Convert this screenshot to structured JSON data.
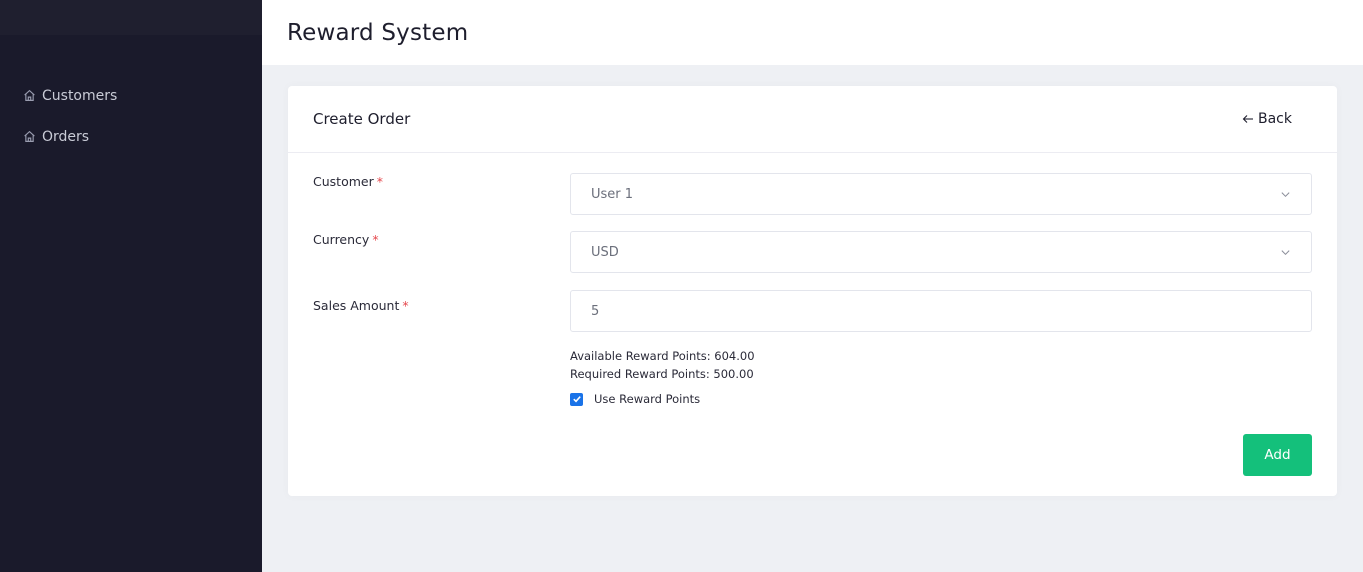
{
  "sidebar": {
    "items": [
      {
        "label": "Customers",
        "icon": "home-icon"
      },
      {
        "label": "Orders",
        "icon": "home-icon"
      }
    ]
  },
  "header": {
    "title": "Reward System"
  },
  "card": {
    "title": "Create Order",
    "back_label": "Back"
  },
  "form": {
    "customer": {
      "label": "Customer",
      "required_mark": "*",
      "value": "User 1"
    },
    "currency": {
      "label": "Currency",
      "required_mark": "*",
      "value": "USD"
    },
    "sales_amount": {
      "label": "Sales Amount",
      "required_mark": "*",
      "value": "5"
    },
    "available_points": "Available Reward Points: 604.00",
    "required_points": "Required Reward Points: 500.00",
    "use_points": {
      "label": "Use Reward Points",
      "checked": true
    },
    "submit_label": "Add"
  },
  "colors": {
    "sidebar_bg": "#1a1a2b",
    "accent_green": "#14c07b",
    "checkbox_blue": "#1a73e8",
    "required_red": "#e5484d"
  }
}
